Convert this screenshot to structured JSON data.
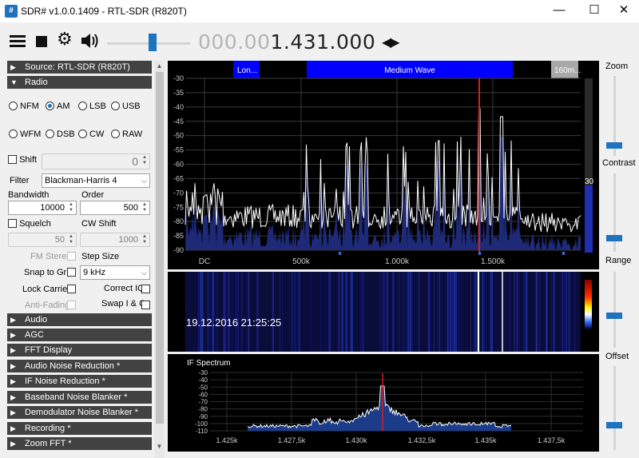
{
  "window": {
    "title": "SDR# v1.0.0.1409 - RTL-SDR (R820T)",
    "icon": "sdrsharp-app-icon",
    "minimize_glyph": "—",
    "maximize_glyph": "☐",
    "close_glyph": "✕"
  },
  "toolbar": {
    "menu_icon": "hamburger-icon",
    "stop_icon": "stop-icon",
    "settings_icon": "gear-icon",
    "volume_icon": "speaker-icon",
    "volume_level": 0.5,
    "frequency_dim": "000.00",
    "frequency_main": "1.431.000",
    "tune_arrows": "◀▶"
  },
  "sidebar": {
    "sections_top": [
      {
        "label": "Source: RTL-SDR (R820T)",
        "expanded": false
      },
      {
        "label": "Radio",
        "expanded": true
      }
    ],
    "radio": {
      "modes_row1": [
        "NFM",
        "AM",
        "LSB",
        "USB"
      ],
      "modes_row2": [
        "WFM",
        "DSB",
        "CW",
        "RAW"
      ],
      "selected_mode": "AM",
      "shift_label": "Shift",
      "shift_value": "0",
      "filter_label": "Filter",
      "filter_value": "Blackman-Harris 4",
      "bandwidth_label": "Bandwidth",
      "bandwidth_value": "10000",
      "order_label": "Order",
      "order_value": "500",
      "squelch_label": "Squelch",
      "squelch_value": "50",
      "cw_shift_label": "CW Shift",
      "cw_shift_value": "1000",
      "fm_stereo_label": "FM Stereo",
      "step_size_label": "Step Size",
      "snap_label": "Snap to Grid",
      "step_value": "9 kHz",
      "lock_carrier_label": "Lock Carrier",
      "correct_iq_label": "Correct IQ",
      "anti_fading_label": "Anti-Fading",
      "swap_iq_label": "Swap I & Q"
    },
    "sections_bottom": [
      "Audio",
      "AGC",
      "FFT Display",
      "Audio Noise Reduction *",
      "IF Noise Reduction *",
      "Baseband Noise Blanker *",
      "Demodulator Noise Blanker *",
      "Recording *",
      "Zoom FFT *"
    ]
  },
  "spectrum": {
    "bands": [
      "Lon...",
      "Medium Wave",
      "160m..."
    ],
    "db_labels": [
      "-30",
      "-35",
      "-40",
      "-45",
      "-50",
      "-55",
      "-60",
      "-65",
      "-70",
      "-75",
      "-80",
      "-85",
      "-90"
    ],
    "freq_labels": [
      "DC",
      "500k",
      "1.000k",
      "1.500k"
    ],
    "level_readout": "30",
    "colors": {
      "trace": "#ffffff",
      "fill": "#1e2a78",
      "marker": "#d42020",
      "band": "#0000ff",
      "band_gray": "#a8a8a8"
    }
  },
  "waterfall": {
    "timestamp": "19.12.2016 21:25:25"
  },
  "if_spectrum": {
    "title": "IF Spectrum",
    "db_labels": [
      "-30",
      "-40",
      "-50",
      "-60",
      "-70",
      "-80",
      "-90",
      "-100",
      "-110"
    ],
    "freq_labels": [
      "1.425k",
      "1.427,5k",
      "1.430k",
      "1.432,5k",
      "1.435k",
      "1.437,5k"
    ]
  },
  "right_panel": {
    "zoom_label": "Zoom",
    "contrast_label": "Contrast",
    "range_label": "Range",
    "offset_label": "Offset"
  }
}
